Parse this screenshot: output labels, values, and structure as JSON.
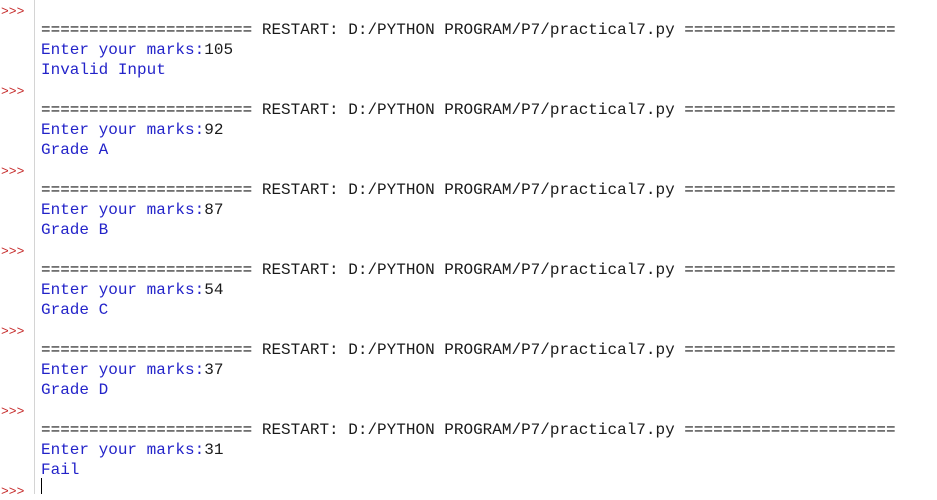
{
  "shell": {
    "prompt": ">>>",
    "runs": [
      {
        "restart": "====================== RESTART: D:/PYTHON PROGRAM/P7/practical7.py ======================",
        "input_prompt": "Enter your marks:",
        "input_value": "105",
        "output": "Invalid Input"
      },
      {
        "restart": "====================== RESTART: D:/PYTHON PROGRAM/P7/practical7.py ======================",
        "input_prompt": "Enter your marks:",
        "input_value": "92",
        "output": "Grade A"
      },
      {
        "restart": "====================== RESTART: D:/PYTHON PROGRAM/P7/practical7.py ======================",
        "input_prompt": "Enter your marks:",
        "input_value": "87",
        "output": "Grade B"
      },
      {
        "restart": "====================== RESTART: D:/PYTHON PROGRAM/P7/practical7.py ======================",
        "input_prompt": "Enter your marks:",
        "input_value": "54",
        "output": "Grade C"
      },
      {
        "restart": "====================== RESTART: D:/PYTHON PROGRAM/P7/practical7.py ======================",
        "input_prompt": "Enter your marks:",
        "input_value": "37",
        "output": "Grade D"
      },
      {
        "restart": "====================== RESTART: D:/PYTHON PROGRAM/P7/practical7.py ======================",
        "input_prompt": "Enter your marks:",
        "input_value": "31",
        "output": "Fail"
      }
    ]
  }
}
